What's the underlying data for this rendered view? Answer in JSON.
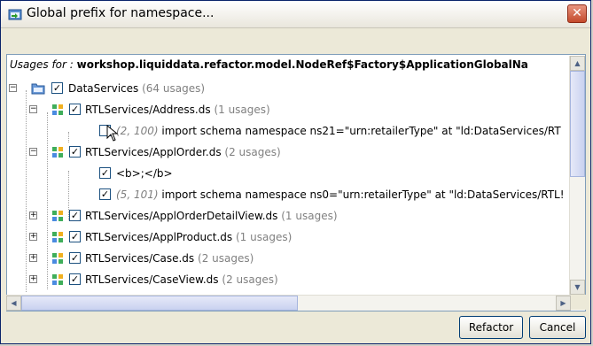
{
  "window": {
    "title": "Global prefix for namespace..."
  },
  "usages": {
    "label": "Usages for :",
    "value": "workshop.liquiddata.refactor.model.NodeRef$Factory$ApplicationGlobalNa"
  },
  "tree": [
    {
      "label": "DataServices",
      "count": "(64 usages)"
    },
    {
      "label": "RTLServices/Address.ds",
      "count": "(1 usages)"
    },
    {
      "loc": "(2, 100)",
      "label": "import schema namespace ns21=\"urn:retailerType\" at \"ld:DataServices/RT"
    },
    {
      "label": "RTLServices/ApplOrder.ds",
      "count": "(2 usages)"
    },
    {
      "label": "<b>;</b>"
    },
    {
      "loc": "(5, 101)",
      "label": "import schema namespace ns0=\"urn:retailerType\" at \"ld:DataServices/RTL!"
    },
    {
      "label": "RTLServices/ApplOrderDetailView.ds",
      "count": "(1 usages)"
    },
    {
      "label": "RTLServices/ApplProduct.ds",
      "count": "(1 usages)"
    },
    {
      "label": "RTLServices/Case.ds",
      "count": "(2 usages)"
    },
    {
      "label": "RTLServices/CaseView.ds",
      "count": "(2 usages)"
    }
  ],
  "buttons": {
    "refactor": "Refactor",
    "cancel": "Cancel"
  },
  "icons": {
    "close": "close-icon",
    "folder": "folder-icon",
    "dataservice": "dataservice-icon",
    "arrow_up": "scroll-up-icon",
    "arrow_down": "scroll-down-icon",
    "arrow_left": "scroll-left-icon",
    "arrow_right": "scroll-right-icon"
  }
}
